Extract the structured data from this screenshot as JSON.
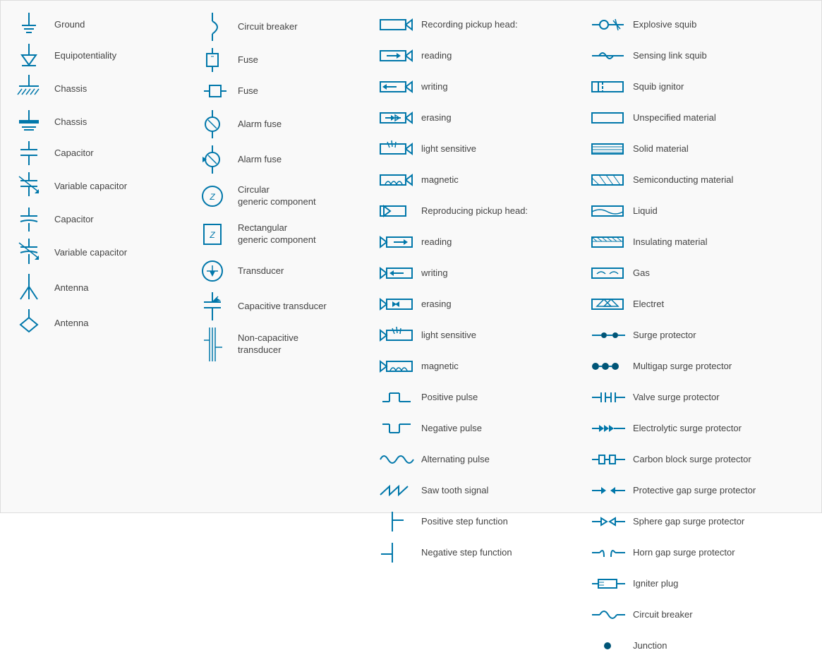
{
  "col1": {
    "items": [
      {
        "id": "ground",
        "label": "Ground"
      },
      {
        "id": "equipotentiality",
        "label": "Equipotentiality"
      },
      {
        "id": "chassis1",
        "label": "Chassis"
      },
      {
        "id": "chassis2",
        "label": "Chassis"
      },
      {
        "id": "capacitor1",
        "label": "Capacitor"
      },
      {
        "id": "variable-capacitor1",
        "label": "Variable capacitor"
      },
      {
        "id": "capacitor2",
        "label": "Capacitor"
      },
      {
        "id": "variable-capacitor2",
        "label": "Variable capacitor"
      },
      {
        "id": "antenna1",
        "label": "Antenna"
      },
      {
        "id": "antenna2",
        "label": "Antenna"
      }
    ]
  },
  "col2": {
    "items": [
      {
        "id": "circuit-breaker",
        "label": "Circuit breaker"
      },
      {
        "id": "fuse1",
        "label": "Fuse"
      },
      {
        "id": "fuse2",
        "label": "Fuse"
      },
      {
        "id": "alarm-fuse1",
        "label": "Alarm fuse"
      },
      {
        "id": "alarm-fuse2",
        "label": "Alarm fuse"
      },
      {
        "id": "circular-generic",
        "label": "Circular\ngeneric component"
      },
      {
        "id": "rectangular-generic",
        "label": "Rectangular\ngeneric component"
      },
      {
        "id": "transducer",
        "label": "Transducer"
      },
      {
        "id": "capacitive-transducer",
        "label": "Capacitive transducer"
      },
      {
        "id": "non-capacitive-transducer",
        "label": "Non-capacitive\ntransducer"
      }
    ]
  },
  "col3": {
    "items": [
      {
        "id": "recording-pickup-head",
        "label": "Recording pickup head:"
      },
      {
        "id": "reading1",
        "label": "reading"
      },
      {
        "id": "writing1",
        "label": "writing"
      },
      {
        "id": "erasing1",
        "label": "erasing"
      },
      {
        "id": "light-sensitive1",
        "label": "light sensitive"
      },
      {
        "id": "magnetic1",
        "label": "magnetic"
      },
      {
        "id": "reproducing-pickup-head",
        "label": "Reproducing pickup head:"
      },
      {
        "id": "reading2",
        "label": "reading"
      },
      {
        "id": "writing2",
        "label": "writing"
      },
      {
        "id": "erasing2",
        "label": "erasing"
      },
      {
        "id": "light-sensitive2",
        "label": "light sensitive"
      },
      {
        "id": "magnetic2",
        "label": "magnetic"
      },
      {
        "id": "positive-pulse",
        "label": "Positive pulse"
      },
      {
        "id": "negative-pulse",
        "label": "Negative pulse"
      },
      {
        "id": "alternating-pulse",
        "label": "Alternating pulse"
      },
      {
        "id": "saw-tooth",
        "label": "Saw tooth signal"
      },
      {
        "id": "positive-step",
        "label": "Positive step function"
      },
      {
        "id": "negative-step",
        "label": "Negative step function"
      }
    ]
  },
  "col4": {
    "items": [
      {
        "id": "explosive-squib",
        "label": "Explosive squib"
      },
      {
        "id": "sensing-link-squib",
        "label": "Sensing link squib"
      },
      {
        "id": "squib-ignitor",
        "label": "Squib ignitor"
      },
      {
        "id": "unspecified-material",
        "label": "Unspecified material"
      },
      {
        "id": "solid-material",
        "label": "Solid material"
      },
      {
        "id": "semiconducting-material",
        "label": "Semiconducting material"
      },
      {
        "id": "liquid",
        "label": "Liquid"
      },
      {
        "id": "insulating-material",
        "label": "Insulating material"
      },
      {
        "id": "gas",
        "label": "Gas"
      },
      {
        "id": "electret",
        "label": "Electret"
      },
      {
        "id": "surge-protector",
        "label": "Surge protector"
      },
      {
        "id": "multigap-surge",
        "label": "Multigap surge protector"
      },
      {
        "id": "valve-surge",
        "label": "Valve surge protector"
      },
      {
        "id": "electrolytic-surge",
        "label": "Electrolytic surge protector"
      },
      {
        "id": "carbon-block-surge",
        "label": "Carbon block surge protector"
      },
      {
        "id": "protective-gap-surge",
        "label": "Protective gap surge protector"
      },
      {
        "id": "sphere-gap-surge",
        "label": "Sphere gap surge protector"
      },
      {
        "id": "horn-gap-surge",
        "label": "Horn gap surge protector"
      },
      {
        "id": "igniter-plug",
        "label": "Igniter plug"
      },
      {
        "id": "circuit-breaker2",
        "label": "Circuit breaker"
      },
      {
        "id": "junction",
        "label": "Junction"
      }
    ]
  }
}
